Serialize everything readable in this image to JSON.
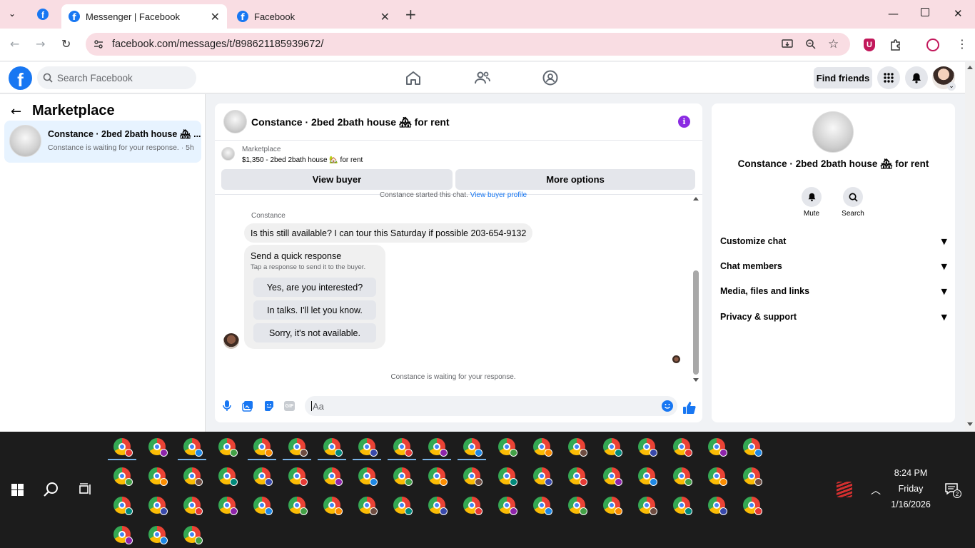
{
  "browser": {
    "tabs": [
      {
        "label": "Messenger | Facebook",
        "active": true
      },
      {
        "label": "Facebook",
        "active": false
      }
    ],
    "url": "facebook.com/messages/t/898621185939672/"
  },
  "fb_header": {
    "logo": "f",
    "search_placeholder": "Search Facebook",
    "find_friends_label": "Find friends"
  },
  "left_panel": {
    "title": "Marketplace",
    "conversation": {
      "name": "Constance · 2bed 2bath house 🏘 ...",
      "preview": "Constance is waiting for your response. · 5h"
    }
  },
  "chat": {
    "title": "Constance · 2bed 2bath house 🏘 for rent",
    "listing_source": "Marketplace",
    "listing_detail": "$1,350 - 2bed 2bath house 🏡 for rent",
    "view_buyer_label": "View buyer",
    "more_options_label": "More options",
    "started_text": "Constance started this chat.",
    "view_profile_link": "View buyer profile",
    "sender": "Constance",
    "message": "Is this still available? I can tour this Saturday if possible 203-654-9132",
    "quick_response_title": "Send a quick response",
    "quick_response_sub": "Tap a response to send it to the buyer.",
    "quick_replies": [
      "Yes, are you interested?",
      "In talks. I'll let you know.",
      "Sorry, it's not available."
    ],
    "waiting_text": "Constance is waiting for your response.",
    "input_placeholder": "Aa"
  },
  "right_panel": {
    "name": "Constance · 2bed 2bath house 🏘 for rent",
    "mute_label": "Mute",
    "search_label": "Search",
    "sections": [
      "Customize chat",
      "Chat members",
      "Media, files and links",
      "Privacy & support"
    ]
  },
  "taskbar": {
    "time": "8:24 PM",
    "day": "Friday",
    "date": "1/16/2026",
    "notification_count": "2"
  },
  "colors": {
    "accent": "#1877f2",
    "tab_bar": "#f9dde3",
    "info_purple": "#8a2be2"
  }
}
